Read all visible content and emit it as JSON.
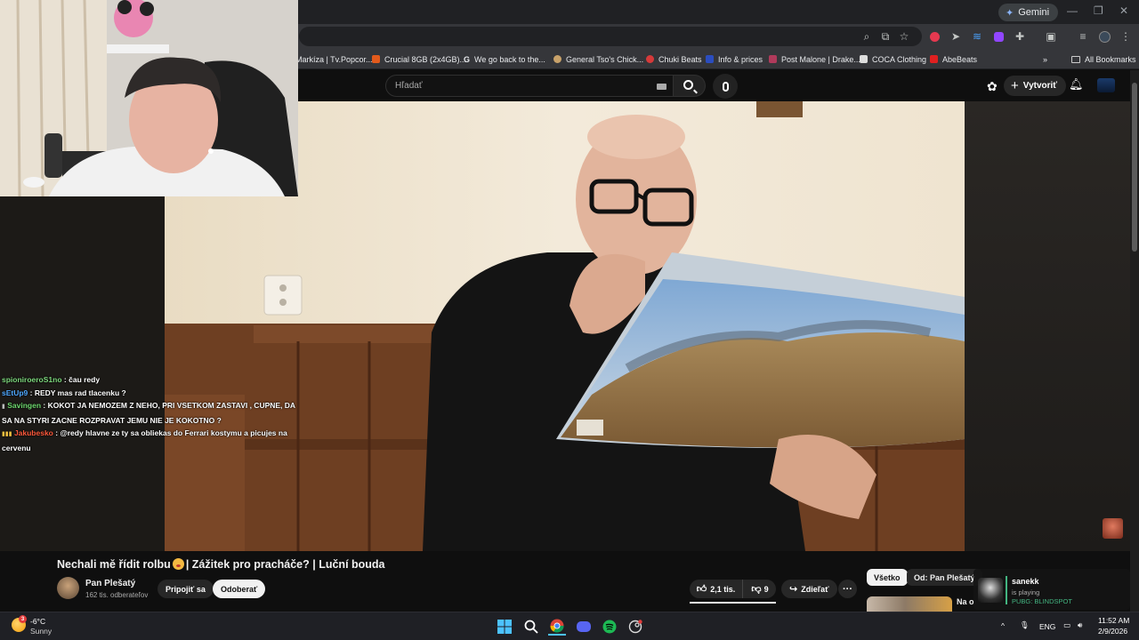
{
  "browser": {
    "gemini_label": "Gemini",
    "bookmarks": [
      {
        "label": "Markíza | Tv.Popcor...",
        "color": "#555555"
      },
      {
        "label": "Crucial 8GB (2x4GB)...",
        "color": "#e25a1c"
      },
      {
        "label": "We go back to the...",
        "color": "#ffffff"
      },
      {
        "label": "General Tso's Chick...",
        "color": "#c8a26a"
      },
      {
        "label": "Chuki Beats",
        "color": "#d63a3a"
      },
      {
        "label": "Info & prices",
        "color": "#2b4dbf"
      },
      {
        "label": "Post Malone | Drake...",
        "color": "#b03a5b"
      },
      {
        "label": "COCA Clothing",
        "color": "#222222"
      },
      {
        "label": "AbeBeats",
        "color": "#e02020"
      }
    ],
    "all_bookmarks_label": "All Bookmarks"
  },
  "youtube": {
    "search_placeholder": "Hľadať",
    "create_label": "Vytvoriť",
    "video_title_part1": "Nechali mě řídit rolbu",
    "video_title_part2": "| Zážitek pro pracháče? | Luční bouda",
    "channel_name": "Pan Plešatý",
    "channel_subs": "162 tis. odberateľov",
    "join_label": "Pripojiť sa",
    "subscribe_label": "Odoberať",
    "like_count": "2,1 tis.",
    "dislike_count": "9",
    "share_label": "Zdieľať",
    "chip_all": "Všetko",
    "chip_from": "Od: Pan Plešatý",
    "next_video_title": "Na o"
  },
  "chat": [
    {
      "user": "spioniroeroS1no",
      "message": "čau redy",
      "badge": ""
    },
    {
      "user": "sEtUp9",
      "message": "REDY mas rad tlacenku ?",
      "badge": ""
    },
    {
      "user": "Savingen",
      "message": "KOKOT JA NEMOZEM Z NEHO, PRI VSETKOM ZASTAVI , CUPNE, DA SA NA STYRI ZACNE ROZPRAVAT JEMU NIE JE KOKOTNO ?",
      "badge": "▮"
    },
    {
      "user": "Jakubesko",
      "message": "@redy hlavne ze ty sa obliekas do Ferrari kostymu a picujes na cervenu",
      "badge": "▮▮▮"
    }
  ],
  "discord_activity": {
    "name": "sanekk",
    "status": "is playing",
    "game": "PUBG: BLINDSPOT"
  },
  "taskbar": {
    "weather_temp": "-6°C",
    "weather_desc": "Sunny",
    "weather_badge": "3",
    "lang": "ENG",
    "time": "11:52 AM",
    "date": "2/9/2026"
  },
  "colors": {
    "youtube_bg": "#0f0f0f",
    "chrome_bg": "#202124",
    "subscribe_bg": "#f1f1f1",
    "discord_green": "#43b581"
  }
}
